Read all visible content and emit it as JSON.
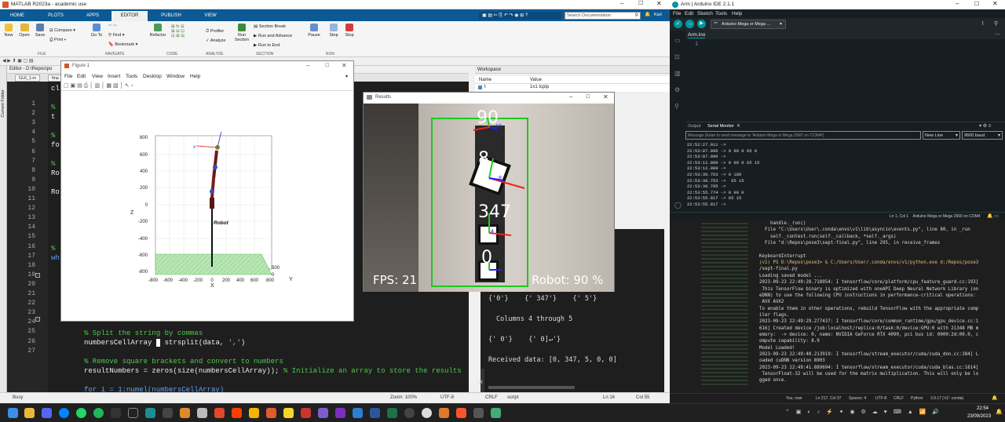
{
  "matlab": {
    "title": "MATLAB R2023a - academic use",
    "tabs": [
      "HOME",
      "PLOTS",
      "APPS",
      "EDITOR",
      "PUBLISH",
      "VIEW"
    ],
    "search_placeholder": "Search Documentation",
    "user": "Karl",
    "ribbon": {
      "new": "New",
      "open": "Open",
      "save": "Save",
      "compare": "Compare",
      "print": "Print",
      "goto": "Go To",
      "find": "Find",
      "bookmark": "Bookmark",
      "refactor": "Refactor",
      "profiler": "Profiler",
      "analyze": "Analyze",
      "run_section": "Run Section",
      "section_break": "Section Break",
      "run_advance": "Run and Advance",
      "run_to_end": "Run to End",
      "pause": "Pause",
      "step": "Step",
      "stop": "Stop",
      "groups": [
        "FILE",
        "NAVIGATE",
        "CODE",
        "ANALYZE",
        "SECTION",
        "RUN"
      ]
    },
    "current_folder": "Current Folder",
    "editor_title": "Editor - D:\\Repos\\po",
    "editor_tabs": [
      "GUI_1.m",
      "fina"
    ],
    "line_numbers": [
      "1",
      "2",
      "3",
      "4",
      "5",
      "6",
      "7",
      "8",
      "9",
      "10",
      "11",
      "12",
      "13",
      "14",
      "15",
      "16",
      "17",
      "18",
      "19",
      "20",
      "21",
      "22",
      "23",
      "24",
      "25",
      "26",
      "27"
    ],
    "code_fragments": [
      "cl",
      "%",
      "t",
      "%",
      "fo",
      "%",
      "Ro",
      "Ro",
      "%",
      "wh"
    ],
    "code_lines": [
      {
        "text": "% Split the string by commas",
        "kind": "comment"
      },
      {
        "pre": "numbersCellArray ",
        "mid": "= ",
        "post": "strsplit(data, ','",
        "str": "',')"
      },
      {
        "text": "% Remove square brackets and convert to numbers",
        "kind": "comment"
      },
      {
        "pre": "resultNumbers = zeros(size(numbersCellArray)); ",
        "comment": "% Initialize an array to store the results"
      },
      {
        "text": "for i = 1:numel(numbersCellArray)",
        "kind": "code"
      }
    ],
    "workspace": {
      "title": "Workspace",
      "col_name": "Name",
      "col_value": "Value",
      "row_name": "t",
      "row_value": "1x1 tcpip"
    },
    "cmd": {
      "row1": [
        "{'0'}",
        "{' 347'}",
        "{' 5'}"
      ],
      "columns": "Columns 4 through 5",
      "row2": [
        "{' 0'}",
        "{' 0]↵'}"
      ],
      "received": "Received data: [0, 347, 5, 0, 0]",
      "fx": "fx"
    },
    "status": {
      "busy": "Busy",
      "zoom": "Zoom: 100%",
      "encoding": "UTF-8",
      "eol": "CRLF",
      "type": "script",
      "ln": "Ln 16",
      "col": "Col 55"
    }
  },
  "figure": {
    "title": "Figure 1",
    "menu": [
      "File",
      "Edit",
      "View",
      "Insert",
      "Tools",
      "Desktop",
      "Window",
      "Help"
    ],
    "axis_z": "Z",
    "axis_x": "X",
    "axis_y": "Y",
    "z_ticks": [
      "800",
      "600",
      "400",
      "200",
      "0",
      "-200",
      "-400",
      "-600",
      "-800"
    ],
    "x_ticks": [
      "-800",
      "-600",
      "-400",
      "-200",
      "0",
      "200",
      "400",
      "600",
      "800"
    ],
    "y_ticks": [
      "500",
      "0"
    ],
    "robot_label": "Robot",
    "z_marker": "z"
  },
  "results": {
    "title": "Results",
    "fps": "FPS: 21",
    "robot": "Robot: 90 %",
    "marker_labels": [
      "90",
      "8",
      "347",
      "0"
    ],
    "marker_small": [
      "12",
      "8",
      "4"
    ]
  },
  "arduino": {
    "title": "Arm | Arduino IDE 2.1.1",
    "menu": [
      "File",
      "Edit",
      "Sketch",
      "Tools",
      "Help"
    ],
    "board": "Arduino Mega or Mega ...",
    "file_tab": "Arm.ino",
    "line1": "1",
    "output_tab": "Output",
    "serial_tab": "Serial Monitor",
    "message_placeholder": "Message (Enter to send message to 'Arduino Mega or Mega 2560' on 'COM4')",
    "newline": "New Line",
    "baud": "9600 baud",
    "serial_lines": [
      "22:52:27.011 ->",
      "22:53:07.996 -> 0 90 0 65 0",
      "22:53:07.996 ->",
      "22:53:12.809 -> 0 90 0 65 15",
      "22:53:12.809 ->",
      "22:53:36.753 -> 0 180",
      "22:53:36.753 ->  65 15",
      "22:53:36.795 ->",
      "22:53:55.774 -> 0 90 0",
      "22:53:55.817 -> 65 15",
      "22:53:55.817 ->"
    ],
    "status_right": "Ln 1, Col 1    Arduino Mega or Mega 2560 on COM4"
  },
  "terminal": {
    "lines": [
      "    handle._run()",
      "  File \"C:\\Users\\User\\.conda\\envs\\v1\\lib\\asyncio\\events.py\", line 80, in _run",
      "    self._context.run(self._callback, *self._args)",
      "  File \"d:\\Repos\\pose3\\sept-final.py\", line 295, in receive_frames",
      "",
      "KeyboardInterrupt",
      "(v1) PS D:\\Repos\\pose3> & C:/Users/User/.conda/envs/v1/python.exe d:/Repos/pose3",
      "/sept-final.py",
      "Loading saved model ...",
      "2023-09-23 22:49:28.718954: I tensorflow/core/platform/cpu_feature_guard.cc:193]",
      " This TensorFlow binary is optimized with oneAPI Deep Neural Network Library (on",
      "eDNN) to use the following CPU instructions in performance-critical operations:",
      " AVX AVX2",
      "To enable them in other operations, rebuild TensorFlow with the appropriate comp",
      "iler flags.",
      "2023-09-23 22:49:29.277437: I tensorflow/core/common_runtime/gpu/gpu_device.cc:1",
      "616] Created device /job:localhost/replica:0/task:0/device:GPU:0 with 21348 MB m",
      "emory:  -> device: 0, name: NVIDIA GeForce RTX 4090, pci bus id: 0000:2d:00.0, c",
      "ompute capability: 8.9",
      "Model Loaded!",
      "2023-09-23 22:49:40.213919: I tensorflow/stream_executor/cuda/cuda_dnn.cc:384] L",
      "oaded cuDNN version 8903",
      "2023-09-23 22:49:41.889694: I tensorflow/stream_executor/cuda/cuda_blas.cc:1614]",
      " TensorFloat-32 will be used for the matrix multiplication. This will only be lo",
      "gged once."
    ],
    "status": [
      "You, now",
      "Ln 217, Col 37",
      "Spaces: 4",
      "UTF-8",
      "CRLF",
      "Python",
      "3.9.17 ('v1': conda)"
    ]
  },
  "taskbar": {
    "time": "22:54",
    "date": "23/09/2023"
  },
  "colors": {
    "matlab_blue": "#0c5a94",
    "green_box": "#1ec81e",
    "terminal_path": "#e5c07b"
  }
}
